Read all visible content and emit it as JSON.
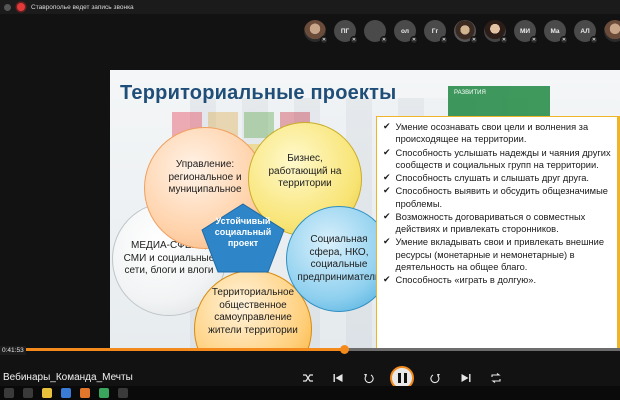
{
  "recording": {
    "text": "Ставрополье ведет запись звонка"
  },
  "participants": [
    {
      "kind": "photo",
      "initials": ""
    },
    {
      "kind": "initials",
      "initials": "ПГ"
    },
    {
      "kind": "blank",
      "initials": ""
    },
    {
      "kind": "initials",
      "initials": "ол"
    },
    {
      "kind": "initials",
      "initials": "Гг"
    },
    {
      "kind": "photo2",
      "initials": ""
    },
    {
      "kind": "photo3",
      "initials": ""
    },
    {
      "kind": "initials",
      "initials": "МИ"
    },
    {
      "kind": "initials",
      "initials": "Ма"
    },
    {
      "kind": "initials",
      "initials": "АЛ"
    },
    {
      "kind": "photo",
      "initials": ""
    }
  ],
  "slide": {
    "title": "Территориальные проекты",
    "badge": "РАЗВИТИЯ",
    "circles": {
      "management": "Управление: региональное и муниципальное",
      "business": "Бизнес, работающий на территории",
      "media": "МЕДИА-СФЕРА, СМИ и социальные сети, блоги и влоги",
      "social": "Социальная сфера, НКО, социальные предприниматели",
      "territorial": "Территориальное общественное самоуправление жители территории"
    },
    "center": "Устойчивый социальный проект",
    "list": [
      "Умение осознавать свои цели и волнения за происходящее на территории.",
      "Способность услышать надежды и чаяния других сообществ и социальных групп на территории.",
      "Способность слушать и слышать друг друга.",
      "Способность выявить и обсудить общезначимые проблемы.",
      "Возможность договариваться о совместных действиях и привлекать сторонников.",
      "Умение вкладывать свои и привлекать внешние ресурсы (монетарные и немонетарные) в деятельность на общее благо.",
      "Способность «играть в долгую»."
    ]
  },
  "player": {
    "time": "0:41:53",
    "progress": 0.555,
    "title": "Вебинары_Команда_Мечты",
    "accent": "#f38a1b"
  }
}
